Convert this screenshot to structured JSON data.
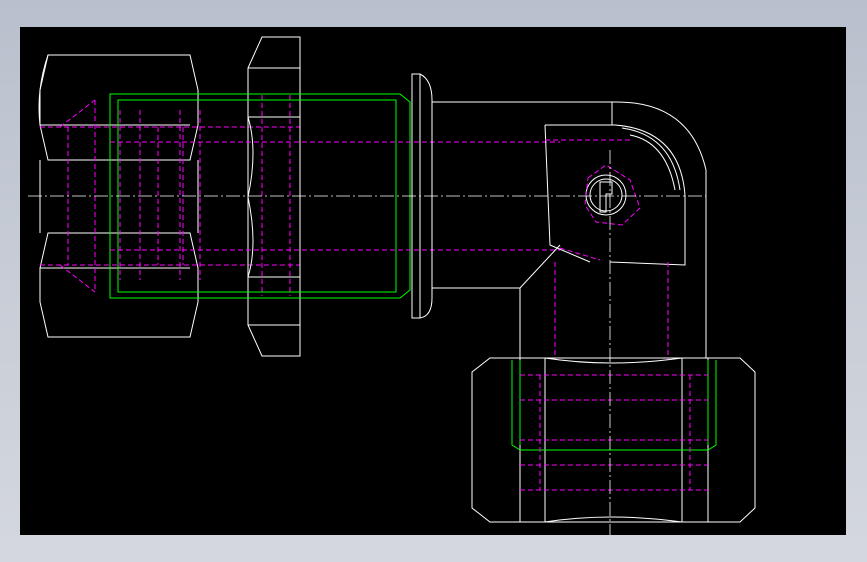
{
  "viewport": {
    "background": "#000000",
    "frame_color": "#c1c7d1"
  },
  "colors": {
    "outline": "#ffffff",
    "hidden_line": "#ff00ff",
    "thread_line": "#00ff00",
    "centerline": "#ffffff"
  },
  "drawing": {
    "parts": [
      {
        "name": "left-hex-nut"
      },
      {
        "name": "middle-hex-nut"
      },
      {
        "name": "threaded-tube-body"
      },
      {
        "name": "tube-flange"
      },
      {
        "name": "elbow-body"
      },
      {
        "name": "bottom-hex-nut"
      }
    ]
  }
}
